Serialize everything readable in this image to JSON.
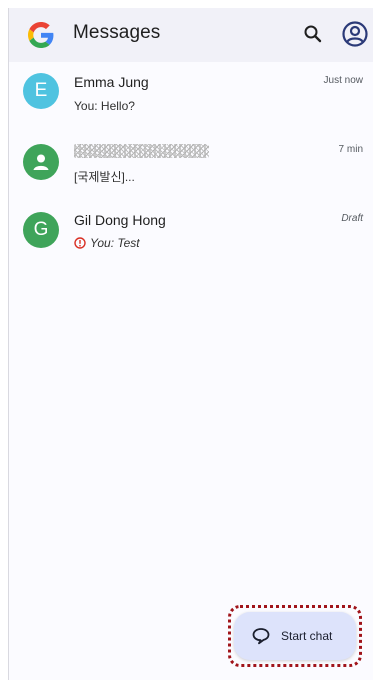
{
  "app_bar": {
    "title": "Messages",
    "logo_icon": "google-g-icon",
    "search_icon": "search-icon",
    "account_icon": "account-circle-icon"
  },
  "conversations": [
    {
      "avatar_letter": "E",
      "avatar_color": "#4fc3e0",
      "name": "Emma Jung",
      "snippet": "You: Hello?",
      "time": "Just now"
    },
    {
      "avatar_icon": "person-icon",
      "avatar_color": "#3fa45a",
      "name_redacted": true,
      "snippet": "[국제발신]...",
      "time": "7 min"
    },
    {
      "avatar_letter": "G",
      "avatar_color": "#3fa45a",
      "name": "Gil Dong Hong",
      "snippet": "You: Test",
      "time": "Draft",
      "status_icon": "error-circle-icon",
      "status_color": "#d93025"
    }
  ],
  "fab": {
    "label": "Start chat",
    "icon": "chat-bubble-icon",
    "background": "#dde3fb",
    "highlight_color": "#a0141a"
  }
}
